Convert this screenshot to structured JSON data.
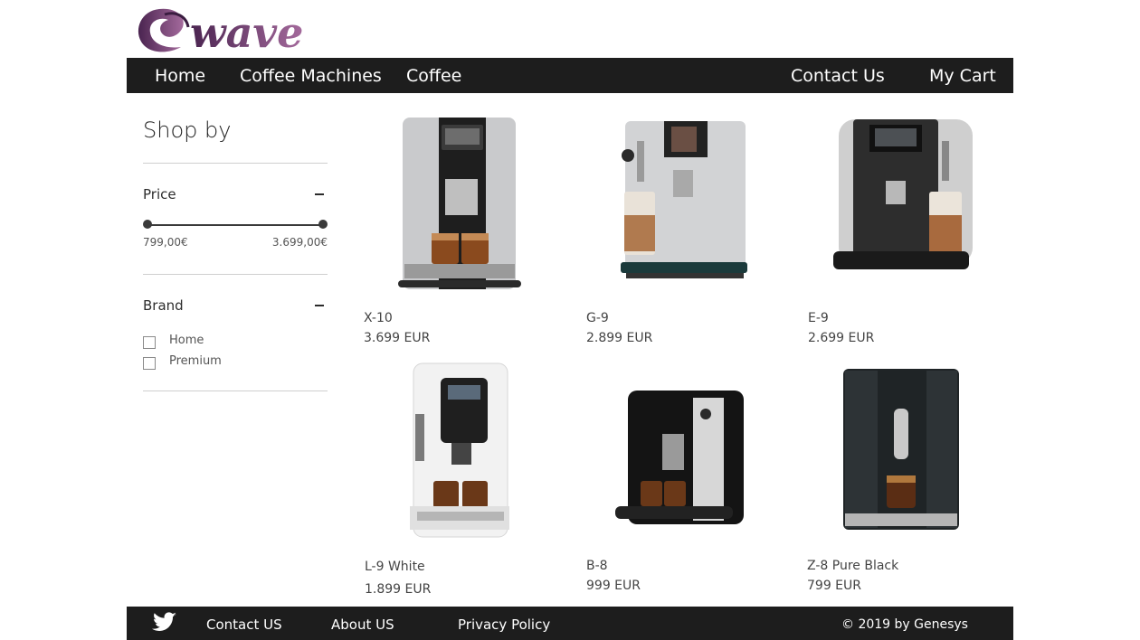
{
  "brand": {
    "logo_text": "wave",
    "logo_color": "#6b3b6e"
  },
  "nav": {
    "home": "Home",
    "coffee_machines": "Coffee Machines",
    "coffee": "Coffee",
    "contact": "Contact Us",
    "cart": "My Cart"
  },
  "sidebar": {
    "title": "Shop by",
    "price": {
      "label": "Price",
      "min_label": "799,00€",
      "max_label": "3.699,00€",
      "range_low": 0.0,
      "range_high": 1.0
    },
    "brand": {
      "label": "Brand",
      "options": [
        {
          "label": "Home"
        },
        {
          "label": "Premium"
        }
      ]
    }
  },
  "products": [
    {
      "name": "X-10",
      "price": "3.699 EUR",
      "style": "silver-twin"
    },
    {
      "name": "G-9",
      "price": "2.899 EUR",
      "style": "silver-latte"
    },
    {
      "name": "E-9",
      "price": "2.699 EUR",
      "style": "dark-latte"
    },
    {
      "name": "L-9 White",
      "price": "1.899 EUR",
      "style": "white-twin"
    },
    {
      "name": "B-8",
      "price": "999 EUR",
      "style": "black-silver"
    },
    {
      "name": "Z-8 Pure Black",
      "price": "799 EUR",
      "style": "pure-black"
    }
  ],
  "footer": {
    "twitter_icon": "twitter-icon",
    "contact": "Contact US",
    "about": "About US",
    "privacy": "Privacy Policy",
    "copyright": "©  2019 by Genesys"
  }
}
